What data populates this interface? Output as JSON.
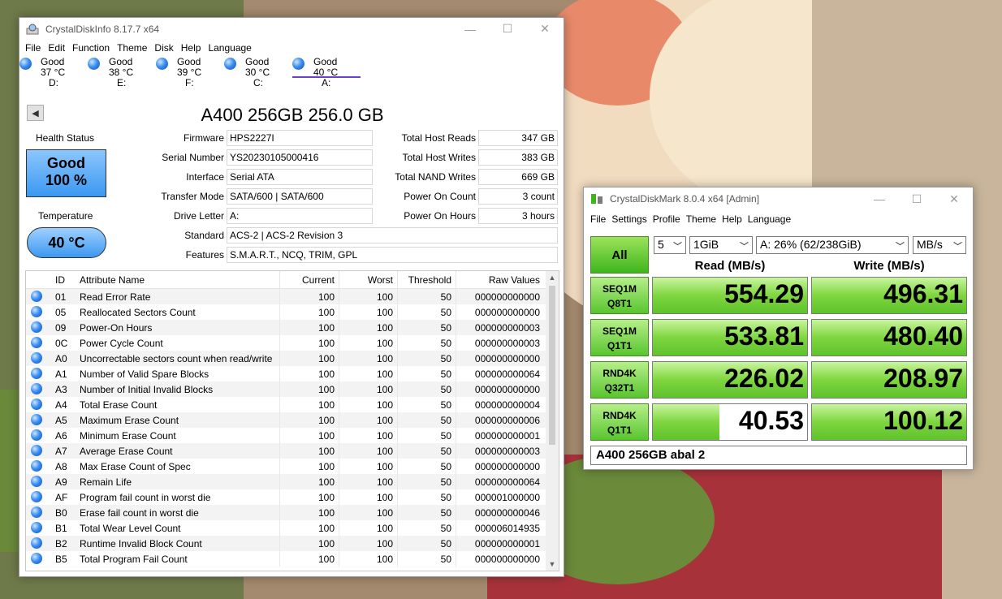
{
  "cdi": {
    "title": "CrystalDiskInfo 8.17.7 x64",
    "menu": [
      "File",
      "Edit",
      "Function",
      "Theme",
      "Disk",
      "Help",
      "Language"
    ],
    "disks": [
      {
        "status": "Good",
        "temp": "37 °C",
        "letter": "D:"
      },
      {
        "status": "Good",
        "temp": "38 °C",
        "letter": "E:"
      },
      {
        "status": "Good",
        "temp": "39 °C",
        "letter": "F:"
      },
      {
        "status": "Good",
        "temp": "30 °C",
        "letter": "C:"
      },
      {
        "status": "Good",
        "temp": "40 °C",
        "letter": "A:"
      }
    ],
    "drive_title": "A400 256GB 256.0 GB",
    "health_label": "Health Status",
    "health_status": "Good",
    "health_percent": "100 %",
    "temp_label": "Temperature",
    "temp_value": "40 °C",
    "firmware_label": "Firmware",
    "firmware": "HPS2227I",
    "serial_label": "Serial Number",
    "serial": "YS20230105000416",
    "interface_label": "Interface",
    "interface": "Serial ATA",
    "transfer_label": "Transfer Mode",
    "transfer": "SATA/600 | SATA/600",
    "letter_label": "Drive Letter",
    "letter": "A:",
    "standard_label": "Standard",
    "standard": "ACS-2 | ACS-2 Revision 3",
    "features_label": "Features",
    "features": "S.M.A.R.T., NCQ, TRIM, GPL",
    "reads_label": "Total Host Reads",
    "reads": "347 GB",
    "writes_label": "Total Host Writes",
    "writes": "383 GB",
    "nand_label": "Total NAND Writes",
    "nand": "669 GB",
    "poc_label": "Power On Count",
    "poc": "3 count",
    "poh_label": "Power On Hours",
    "poh": "3 hours",
    "columns": [
      "ID",
      "Attribute Name",
      "Current",
      "Worst",
      "Threshold",
      "Raw Values"
    ],
    "attributes": [
      {
        "id": "01",
        "name": "Read Error Rate",
        "cur": "100",
        "worst": "100",
        "thr": "50",
        "raw": "000000000000"
      },
      {
        "id": "05",
        "name": "Reallocated Sectors Count",
        "cur": "100",
        "worst": "100",
        "thr": "50",
        "raw": "000000000000"
      },
      {
        "id": "09",
        "name": "Power-On Hours",
        "cur": "100",
        "worst": "100",
        "thr": "50",
        "raw": "000000000003"
      },
      {
        "id": "0C",
        "name": "Power Cycle Count",
        "cur": "100",
        "worst": "100",
        "thr": "50",
        "raw": "000000000003"
      },
      {
        "id": "A0",
        "name": "Uncorrectable sectors count when read/write",
        "cur": "100",
        "worst": "100",
        "thr": "50",
        "raw": "000000000000"
      },
      {
        "id": "A1",
        "name": "Number of Valid Spare Blocks",
        "cur": "100",
        "worst": "100",
        "thr": "50",
        "raw": "000000000064"
      },
      {
        "id": "A3",
        "name": "Number of Initial Invalid Blocks",
        "cur": "100",
        "worst": "100",
        "thr": "50",
        "raw": "000000000000"
      },
      {
        "id": "A4",
        "name": "Total Erase Count",
        "cur": "100",
        "worst": "100",
        "thr": "50",
        "raw": "000000000004"
      },
      {
        "id": "A5",
        "name": "Maximum Erase Count",
        "cur": "100",
        "worst": "100",
        "thr": "50",
        "raw": "000000000006"
      },
      {
        "id": "A6",
        "name": "Minimum Erase Count",
        "cur": "100",
        "worst": "100",
        "thr": "50",
        "raw": "000000000001"
      },
      {
        "id": "A7",
        "name": "Average Erase Count",
        "cur": "100",
        "worst": "100",
        "thr": "50",
        "raw": "000000000003"
      },
      {
        "id": "A8",
        "name": "Max Erase Count of Spec",
        "cur": "100",
        "worst": "100",
        "thr": "50",
        "raw": "000000000000"
      },
      {
        "id": "A9",
        "name": "Remain Life",
        "cur": "100",
        "worst": "100",
        "thr": "50",
        "raw": "000000000064"
      },
      {
        "id": "AF",
        "name": "Program fail count in worst die",
        "cur": "100",
        "worst": "100",
        "thr": "50",
        "raw": "000001000000"
      },
      {
        "id": "B0",
        "name": "Erase fail count in worst die",
        "cur": "100",
        "worst": "100",
        "thr": "50",
        "raw": "000000000046"
      },
      {
        "id": "B1",
        "name": "Total Wear Level Count",
        "cur": "100",
        "worst": "100",
        "thr": "50",
        "raw": "000006014935"
      },
      {
        "id": "B2",
        "name": "Runtime Invalid Block Count",
        "cur": "100",
        "worst": "100",
        "thr": "50",
        "raw": "000000000001"
      },
      {
        "id": "B5",
        "name": "Total Program Fail Count",
        "cur": "100",
        "worst": "100",
        "thr": "50",
        "raw": "000000000000"
      }
    ]
  },
  "cdm": {
    "title": "CrystalDiskMark 8.0.4 x64 [Admin]",
    "menu": [
      "File",
      "Settings",
      "Profile",
      "Theme",
      "Help",
      "Language"
    ],
    "all_label": "All",
    "count": "5",
    "size": "1GiB",
    "drive": "A: 26% (62/238GiB)",
    "unit": "MB/s",
    "read_head": "Read (MB/s)",
    "write_head": "Write (MB/s)",
    "tests": [
      {
        "l1": "SEQ1M",
        "l2": "Q8T1",
        "read": "554.29",
        "write": "496.31",
        "read_fill": 1.0,
        "write_fill": 1.0
      },
      {
        "l1": "SEQ1M",
        "l2": "Q1T1",
        "read": "533.81",
        "write": "480.40",
        "read_fill": 1.0,
        "write_fill": 1.0
      },
      {
        "l1": "RND4K",
        "l2": "Q32T1",
        "read": "226.02",
        "write": "208.97",
        "read_fill": 1.0,
        "write_fill": 1.0
      },
      {
        "l1": "RND4K",
        "l2": "Q1T1",
        "read": "40.53",
        "write": "100.12",
        "read_fill": 0.43,
        "write_fill": 1.0
      }
    ],
    "comment": "A400 256GB abal 2"
  }
}
